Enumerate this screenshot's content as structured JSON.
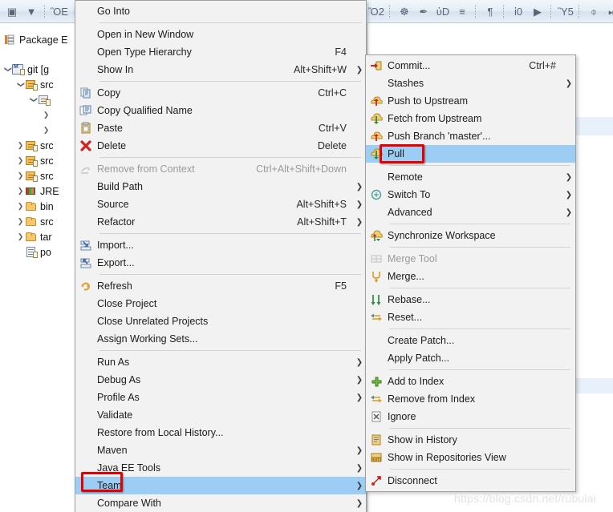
{
  "toolbar": {
    "left_buttons": [
      {
        "name": "new-wizard-icon",
        "glyph": "▣"
      },
      {
        "name": "new-dropdown-arrow-icon",
        "glyph": "▼"
      },
      {
        "name": "save-icon",
        "glyph": "ὋE"
      },
      {
        "name": "save-all-icon",
        "glyph": "❐"
      }
    ],
    "right_buttons": [
      {
        "name": "open-type-icon",
        "glyph": "Ὄ2"
      },
      {
        "name": "new-java-package-icon",
        "glyph": "☸"
      },
      {
        "name": "quick-access-icon",
        "glyph": "✒"
      },
      {
        "name": "search-icon",
        "glyph": "ὐD"
      },
      {
        "name": "toggle-block-selection-icon",
        "glyph": "≡"
      },
      {
        "name": "show-whitespace-icon",
        "glyph": "¶"
      },
      {
        "name": "open-browser-icon",
        "glyph": "ἱ0"
      },
      {
        "name": "run-last-tool-icon",
        "glyph": "▶"
      },
      {
        "name": "open-console-icon",
        "glyph": "Ὓ5"
      },
      {
        "name": "skip-breakpoints-icon",
        "glyph": "⌽"
      },
      {
        "name": "step-over-icon",
        "glyph": "⏭"
      },
      {
        "name": "pause-icon",
        "glyph": "⏸"
      }
    ]
  },
  "left_panel": {
    "tab_label": "Package E",
    "tab_icon": "package-explorer-icon",
    "tree": [
      {
        "indent": 0,
        "twisty": "open",
        "icon": "git-project-icon",
        "label": "git  [g"
      },
      {
        "indent": 1,
        "twisty": "open",
        "icon": "source-folder-icon",
        "label": "src"
      },
      {
        "indent": 2,
        "twisty": "open",
        "icon": "package-icon",
        "label": ""
      },
      {
        "indent": 3,
        "twisty": "closed",
        "icon": "none",
        "label": ""
      },
      {
        "indent": 3,
        "twisty": "closed",
        "icon": "none",
        "label": ""
      },
      {
        "indent": 1,
        "twisty": "closed",
        "icon": "source-folder-icon",
        "label": "src"
      },
      {
        "indent": 1,
        "twisty": "closed",
        "icon": "source-folder-icon",
        "label": "src"
      },
      {
        "indent": 1,
        "twisty": "closed",
        "icon": "source-folder-icon",
        "label": "src"
      },
      {
        "indent": 1,
        "twisty": "closed",
        "icon": "jre-library-icon",
        "label": "JRE"
      },
      {
        "indent": 1,
        "twisty": "closed",
        "icon": "folder-icon",
        "label": "bin"
      },
      {
        "indent": 1,
        "twisty": "closed",
        "icon": "folder-icon",
        "label": "src"
      },
      {
        "indent": 1,
        "twisty": "closed",
        "icon": "folder-icon",
        "label": "tar"
      },
      {
        "indent": 1,
        "twisty": "none",
        "icon": "xml-file-icon",
        "label": "po"
      }
    ]
  },
  "context_menu": {
    "name": "project-context-menu",
    "items": [
      {
        "type": "item",
        "label": "Go Into",
        "accel": "",
        "icon": "",
        "arrow": false,
        "disabled": false,
        "selected": false
      },
      {
        "type": "separator"
      },
      {
        "type": "item",
        "label": "Open in New Window",
        "accel": "",
        "icon": "",
        "arrow": false,
        "disabled": false,
        "selected": false
      },
      {
        "type": "item",
        "label": "Open Type Hierarchy",
        "accel": "F4",
        "icon": "",
        "arrow": false,
        "disabled": false,
        "selected": false
      },
      {
        "type": "item",
        "label": "Show In",
        "accel": "Alt+Shift+W",
        "icon": "",
        "arrow": true,
        "disabled": false,
        "selected": false
      },
      {
        "type": "separator"
      },
      {
        "type": "item",
        "label": "Copy",
        "accel": "Ctrl+C",
        "icon": "copy-icon",
        "arrow": false,
        "disabled": false,
        "selected": false
      },
      {
        "type": "item",
        "label": "Copy Qualified Name",
        "accel": "",
        "icon": "copy-qualified-name-icon",
        "arrow": false,
        "disabled": false,
        "selected": false
      },
      {
        "type": "item",
        "label": "Paste",
        "accel": "Ctrl+V",
        "icon": "paste-icon",
        "arrow": false,
        "disabled": false,
        "selected": false
      },
      {
        "type": "item",
        "label": "Delete",
        "accel": "Delete",
        "icon": "delete-icon",
        "arrow": false,
        "disabled": false,
        "selected": false
      },
      {
        "type": "separator"
      },
      {
        "type": "item",
        "label": "Remove from Context",
        "accel": "Ctrl+Alt+Shift+Down",
        "icon": "remove-from-context-icon",
        "arrow": false,
        "disabled": true,
        "selected": false
      },
      {
        "type": "item",
        "label": "Build Path",
        "accel": "",
        "icon": "",
        "arrow": true,
        "disabled": false,
        "selected": false
      },
      {
        "type": "item",
        "label": "Source",
        "accel": "Alt+Shift+S",
        "icon": "",
        "arrow": true,
        "disabled": false,
        "selected": false
      },
      {
        "type": "item",
        "label": "Refactor",
        "accel": "Alt+Shift+T",
        "icon": "",
        "arrow": true,
        "disabled": false,
        "selected": false
      },
      {
        "type": "separator"
      },
      {
        "type": "item",
        "label": "Import...",
        "accel": "",
        "icon": "import-icon",
        "arrow": false,
        "disabled": false,
        "selected": false
      },
      {
        "type": "item",
        "label": "Export...",
        "accel": "",
        "icon": "export-icon",
        "arrow": false,
        "disabled": false,
        "selected": false
      },
      {
        "type": "separator"
      },
      {
        "type": "item",
        "label": "Refresh",
        "accel": "F5",
        "icon": "refresh-icon",
        "arrow": false,
        "disabled": false,
        "selected": false
      },
      {
        "type": "item",
        "label": "Close Project",
        "accel": "",
        "icon": "",
        "arrow": false,
        "disabled": false,
        "selected": false
      },
      {
        "type": "item",
        "label": "Close Unrelated Projects",
        "accel": "",
        "icon": "",
        "arrow": false,
        "disabled": false,
        "selected": false
      },
      {
        "type": "item",
        "label": "Assign Working Sets...",
        "accel": "",
        "icon": "",
        "arrow": false,
        "disabled": false,
        "selected": false
      },
      {
        "type": "separator"
      },
      {
        "type": "item",
        "label": "Run As",
        "accel": "",
        "icon": "",
        "arrow": true,
        "disabled": false,
        "selected": false
      },
      {
        "type": "item",
        "label": "Debug As",
        "accel": "",
        "icon": "",
        "arrow": true,
        "disabled": false,
        "selected": false
      },
      {
        "type": "item",
        "label": "Profile As",
        "accel": "",
        "icon": "",
        "arrow": true,
        "disabled": false,
        "selected": false
      },
      {
        "type": "item",
        "label": "Validate",
        "accel": "",
        "icon": "",
        "arrow": false,
        "disabled": false,
        "selected": false
      },
      {
        "type": "item",
        "label": "Restore from Local History...",
        "accel": "",
        "icon": "",
        "arrow": false,
        "disabled": false,
        "selected": false
      },
      {
        "type": "item",
        "label": "Maven",
        "accel": "",
        "icon": "",
        "arrow": true,
        "disabled": false,
        "selected": false
      },
      {
        "type": "item",
        "label": "Java EE Tools",
        "accel": "",
        "icon": "",
        "arrow": true,
        "disabled": false,
        "selected": false
      },
      {
        "type": "item",
        "label": "Team",
        "accel": "",
        "icon": "",
        "arrow": true,
        "disabled": false,
        "selected": true
      },
      {
        "type": "item",
        "label": "Compare With",
        "accel": "",
        "icon": "",
        "arrow": true,
        "disabled": false,
        "selected": false
      }
    ]
  },
  "git_submenu": {
    "name": "team-git-submenu",
    "items": [
      {
        "type": "item",
        "label": "Commit...",
        "accel": "Ctrl+#",
        "icon": "commit-icon",
        "arrow": false,
        "disabled": false,
        "selected": false
      },
      {
        "type": "item",
        "label": "Stashes",
        "accel": "",
        "icon": "",
        "arrow": true,
        "disabled": false,
        "selected": false
      },
      {
        "type": "item",
        "label": "Push to Upstream",
        "accel": "",
        "icon": "push-upstream-icon",
        "arrow": false,
        "disabled": false,
        "selected": false
      },
      {
        "type": "item",
        "label": "Fetch from Upstream",
        "accel": "",
        "icon": "fetch-upstream-icon",
        "arrow": false,
        "disabled": false,
        "selected": false
      },
      {
        "type": "item",
        "label": "Push Branch 'master'...",
        "accel": "",
        "icon": "push-branch-icon",
        "arrow": false,
        "disabled": false,
        "selected": false
      },
      {
        "type": "item",
        "label": "Pull",
        "accel": "",
        "icon": "pull-icon",
        "arrow": false,
        "disabled": false,
        "selected": true
      },
      {
        "type": "separator"
      },
      {
        "type": "item",
        "label": "Remote",
        "accel": "",
        "icon": "",
        "arrow": true,
        "disabled": false,
        "selected": false
      },
      {
        "type": "item",
        "label": "Switch To",
        "accel": "",
        "icon": "switch-to-icon",
        "arrow": true,
        "disabled": false,
        "selected": false
      },
      {
        "type": "item",
        "label": "Advanced",
        "accel": "",
        "icon": "",
        "arrow": true,
        "disabled": false,
        "selected": false
      },
      {
        "type": "separator"
      },
      {
        "type": "item",
        "label": "Synchronize Workspace",
        "accel": "",
        "icon": "synchronize-icon",
        "arrow": false,
        "disabled": false,
        "selected": false
      },
      {
        "type": "separator"
      },
      {
        "type": "item",
        "label": "Merge Tool",
        "accel": "",
        "icon": "merge-tool-icon",
        "arrow": false,
        "disabled": true,
        "selected": false
      },
      {
        "type": "item",
        "label": "Merge...",
        "accel": "",
        "icon": "merge-icon",
        "arrow": false,
        "disabled": false,
        "selected": false
      },
      {
        "type": "separator"
      },
      {
        "type": "item",
        "label": "Rebase...",
        "accel": "",
        "icon": "rebase-icon",
        "arrow": false,
        "disabled": false,
        "selected": false
      },
      {
        "type": "item",
        "label": "Reset...",
        "accel": "",
        "icon": "reset-icon",
        "arrow": false,
        "disabled": false,
        "selected": false
      },
      {
        "type": "separator"
      },
      {
        "type": "item",
        "label": "Create Patch...",
        "accel": "",
        "icon": "",
        "arrow": false,
        "disabled": false,
        "selected": false
      },
      {
        "type": "item",
        "label": "Apply Patch...",
        "accel": "",
        "icon": "",
        "arrow": false,
        "disabled": false,
        "selected": false
      },
      {
        "type": "separator"
      },
      {
        "type": "item",
        "label": "Add to Index",
        "accel": "",
        "icon": "add-to-index-icon",
        "arrow": false,
        "disabled": false,
        "selected": false
      },
      {
        "type": "item",
        "label": "Remove from Index",
        "accel": "",
        "icon": "remove-from-index-icon",
        "arrow": false,
        "disabled": false,
        "selected": false
      },
      {
        "type": "item",
        "label": "Ignore",
        "accel": "",
        "icon": "ignore-icon",
        "arrow": false,
        "disabled": false,
        "selected": false
      },
      {
        "type": "separator"
      },
      {
        "type": "item",
        "label": "Show in History",
        "accel": "",
        "icon": "show-in-history-icon",
        "arrow": false,
        "disabled": false,
        "selected": false
      },
      {
        "type": "item",
        "label": "Show in Repositories View",
        "accel": "",
        "icon": "show-in-repositories-icon",
        "arrow": false,
        "disabled": false,
        "selected": false
      },
      {
        "type": "separator"
      },
      {
        "type": "item",
        "label": "Disconnect",
        "accel": "",
        "icon": "disconnect-icon",
        "arrow": false,
        "disabled": false,
        "selected": false
      }
    ]
  },
  "annotations": [
    {
      "name": "redbox-pull",
      "target": "Pull",
      "color": "#e40000"
    },
    {
      "name": "redbox-team",
      "target": "Team",
      "color": "#e40000"
    }
  ],
  "watermark": {
    "text": "https://blog.csdn.net/rubulai"
  }
}
